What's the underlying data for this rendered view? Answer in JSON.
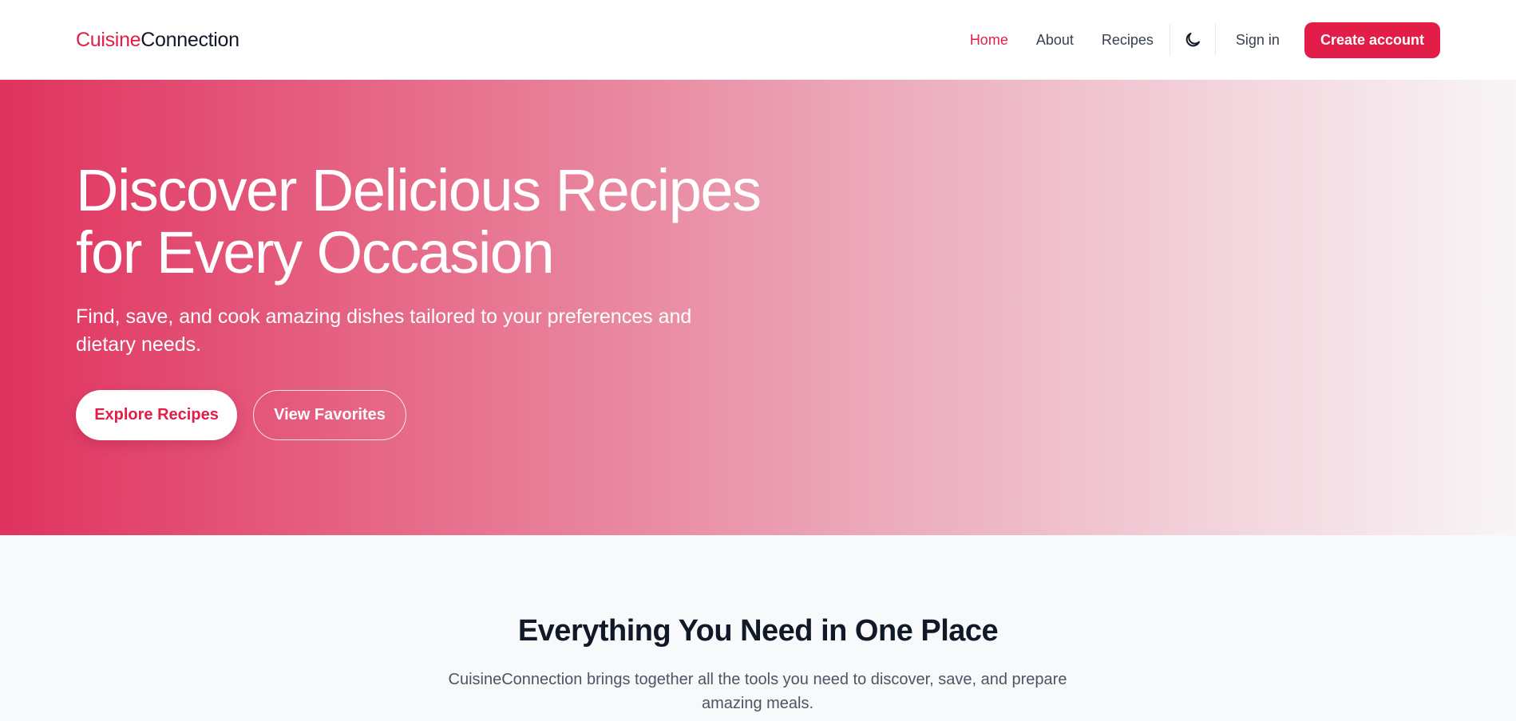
{
  "header": {
    "logo_part1": "Cuisine",
    "logo_part2": "Connection",
    "nav": {
      "home": "Home",
      "about": "About",
      "recipes": "Recipes"
    },
    "theme_toggle_icon": "moon-icon",
    "signin": "Sign in",
    "create_account": "Create account"
  },
  "hero": {
    "title_line1": "Discover Delicious Recipes",
    "title_line2": "for Every Occasion",
    "subtitle": "Find, save, and cook amazing dishes tailored to your preferences and dietary needs.",
    "primary_button": "Explore Recipes",
    "secondary_button": "View Favorites"
  },
  "features": {
    "title": "Everything You Need in One Place",
    "subtitle": "CuisineConnection brings together all the tools you need to discover, save, and prepare amazing meals."
  },
  "colors": {
    "accent": "#e11d48",
    "hero_gradient_start": "#e0335f",
    "hero_gradient_end": "#f8f5f6",
    "background": "#f8f9fb"
  }
}
